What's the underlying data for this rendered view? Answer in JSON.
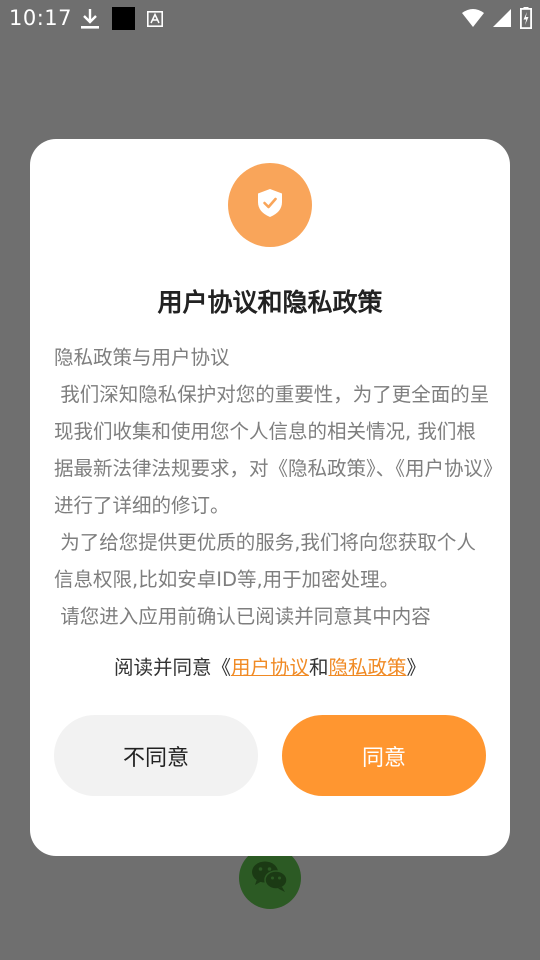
{
  "status_bar": {
    "time": "10:17",
    "left_icons": [
      "download-icon",
      "black-square-icon",
      "text-a-icon"
    ],
    "right_icons": [
      "wifi-icon",
      "signal-icon",
      "battery-charging-icon"
    ]
  },
  "dialog": {
    "badge_icon": "shield-check-icon",
    "badge_color": "#f9a55a",
    "title": "用户协议和隐私政策",
    "body": [
      "隐私政策与用户协议",
      " 我们深知隐私保护对您的重要性，为了更全面的呈现我们收集和使用您个人信息的相关情况, 我们根据最新法律法规要求，对《隐私政策》、《用户协议》进行了详细的修订。",
      " 为了给您提供更优质的服务,我们将向您获取个人信息权限,比如安卓ID等,用于加密处理。",
      " 请您进入应用前确认已阅读并同意其中内容"
    ],
    "agree_prefix": "阅读并同意《",
    "user_agreement_link": "用户协议",
    "agree_middle": "和",
    "privacy_policy_link": "隐私政策",
    "agree_suffix": "》",
    "disagree_button": "不同意",
    "agree_button": "同意",
    "accent_color": "#ff9630"
  },
  "background": {
    "fab_icon": "wechat-icon"
  }
}
